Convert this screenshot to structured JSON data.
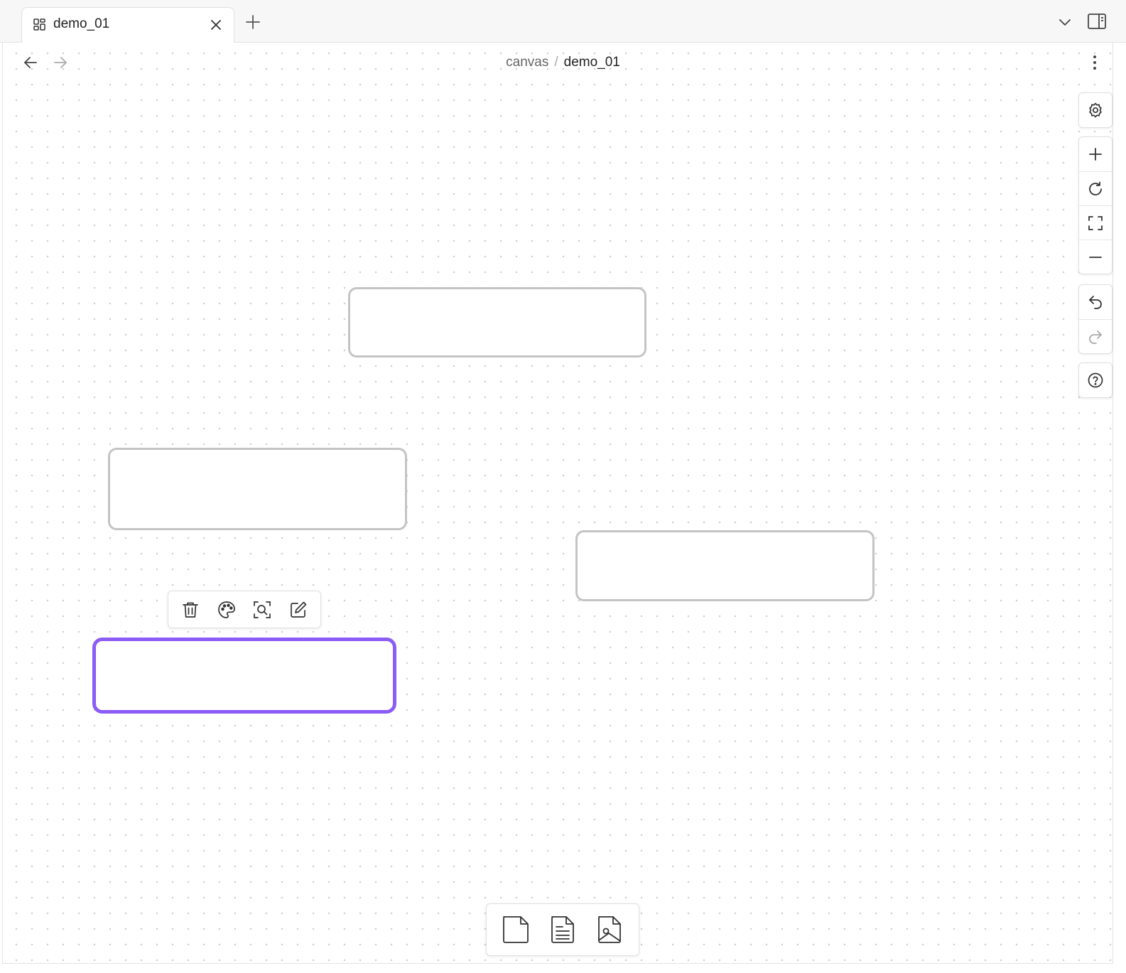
{
  "tab": {
    "title": "demo_01",
    "icon": "canvas-grid-icon"
  },
  "header": {
    "breadcrumb": {
      "parent": "canvas",
      "separator": "/",
      "current": "demo_01"
    }
  },
  "icons": {
    "close": "close-icon",
    "new_tab": "plus-icon",
    "tab_list": "chevron-down-icon",
    "sidebar": "sidebar-toggle-icon",
    "back": "arrow-left-icon",
    "forward": "arrow-right-icon",
    "more": "more-vertical-icon"
  },
  "canvas_controls": {
    "settings": "settings-icon",
    "zoom_group": [
      "zoom-in-icon",
      "reset-zoom-icon",
      "zoom-to-fit-icon",
      "zoom-out-icon"
    ],
    "history_group": [
      "undo-icon",
      "redo-icon"
    ],
    "help": "help-icon"
  },
  "node_toolbar": [
    "trash-icon",
    "palette-icon",
    "zoom-to-node-icon",
    "edit-icon"
  ],
  "card_menu": [
    "new-card-icon",
    "note-card-icon",
    "media-card-icon"
  ],
  "colors": {
    "selection": "#8b5cf6",
    "node_border": "#c4c4c4",
    "grid_dot": "#cfcfcf"
  },
  "nodes": [
    {
      "id": "node-1",
      "selected": false,
      "text": ""
    },
    {
      "id": "node-2",
      "selected": false,
      "text": ""
    },
    {
      "id": "node-3",
      "selected": false,
      "text": ""
    },
    {
      "id": "node-4",
      "selected": true,
      "text": ""
    }
  ]
}
